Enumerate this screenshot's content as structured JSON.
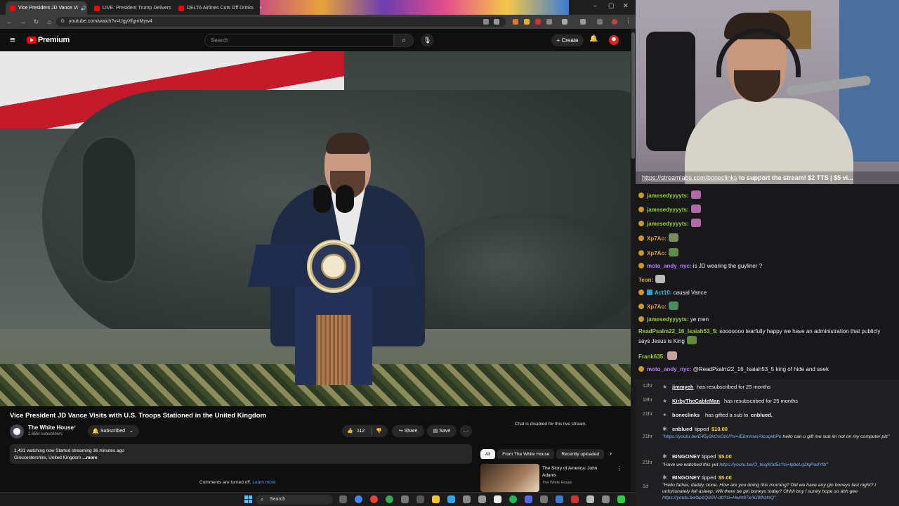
{
  "browser": {
    "tabs": [
      {
        "label": "Vice President JD Vance Vi"
      },
      {
        "label": "LIVE: President Trump Delivers"
      },
      {
        "label": "DELTA Airlines Cuts Off Drinks"
      }
    ],
    "new_tab": "+",
    "url": "youtube.com/watch?v=UgyXfgmMyw4",
    "win_min": "–",
    "win_max": "▢",
    "win_close": "✕"
  },
  "youtube": {
    "brand": "Premium",
    "search_placeholder": "Search",
    "create_label": "Create",
    "video": {
      "title": "Vice President JD Vance Visits with U.S. Troops Stationed in the United Kingdom",
      "channel": "The White House",
      "subscribers": "2.65M subscribers",
      "subscribed_label": "Subscribed",
      "likes": "112",
      "share_label": "Share",
      "save_label": "Save",
      "description_line1": "1,431 watching now  Started streaming 36 minutes ago",
      "description_line2": "Gloucestershire, United Kingdom",
      "description_more": "...more"
    },
    "comments_off": "Comments are turned off.",
    "learn_more": "Learn more",
    "chat_disabled": "Chat is disabled for this live stream.",
    "chips": [
      "All",
      "From The White House",
      "Recently uploaded"
    ],
    "recommendation": {
      "title": "The Story of America: John Adams",
      "channel": "The White House"
    }
  },
  "stream": {
    "ticker_link": "https://streamlabs.com/boneclinks",
    "ticker_text": " to support the stream! $2 TTS | $5 vi..."
  },
  "chat": {
    "messages": [
      {
        "user": "jamesedyyyyts:",
        "text": "",
        "color": "#9acd32",
        "emote": "#b06aa6"
      },
      {
        "user": "jamesedyyyyts:",
        "text": "",
        "color": "#9acd32",
        "emote": "#b06aa6"
      },
      {
        "user": "jamesedyyyyts:",
        "text": "",
        "color": "#9acd32",
        "emote": "#b06aa6"
      },
      {
        "user": "Xp7Ao:",
        "text": "",
        "color": "#daa520",
        "emote": "#7a8c5e"
      },
      {
        "user": "Xp7Ao:",
        "text": "",
        "color": "#daa520",
        "emote": "#5e8c4a"
      },
      {
        "user": "moto_andy_nyc:",
        "text": " is JD wearing the guyliner ?",
        "color": "#b77fff",
        "emote": ""
      },
      {
        "user": "Teon:",
        "text": "",
        "color": "#daa520",
        "emote": "#bbbbbb"
      },
      {
        "user": "Act10:",
        "text": " causal Vance",
        "color": "#1ec8e6",
        "emote": ""
      },
      {
        "user": "Xp7Ao:",
        "text": "",
        "color": "#daa520",
        "emote": "#4a8c5e"
      },
      {
        "user": "jamesedyyyyts:",
        "text": " ye men",
        "color": "#9acd32",
        "emote": ""
      },
      {
        "user": "ReadPsalm22_16_Isaiah53_5:",
        "text": " sooooooo tearfully happy we have an administration that publicly says Jesus is King",
        "color": "#9acd32",
        "emote": "#5f8c3a"
      },
      {
        "user": "Frank635:",
        "text": "",
        "color": "#9acd32",
        "emote": "#c7a0a0"
      },
      {
        "user": "moto_andy_nyc:",
        "text": " @ReadPsalm22_16_Isaiah53_5 king of hide and seek",
        "color": "#b77fff",
        "emote": ""
      }
    ]
  },
  "events": {
    "resubs": [
      {
        "time": "12hr",
        "name": "jimmyeh",
        "text": "has resubscribed for 25 months"
      },
      {
        "time": "18hr",
        "name": "KirbyTheCableMan",
        "text": "has resubscribed for 25 months"
      }
    ],
    "gift": {
      "time": "21hr",
      "name": "boneclinks",
      "text": "has gifted a sub to",
      "target": "cnblued."
    },
    "tips": [
      {
        "time": "21hr",
        "name": "cnblued",
        "tipped": "tipped",
        "amount": "$10.00",
        "link": "\"https://youtu.be/E45y2kOsOzU?si=IEbmmwrAlcoqxbPe",
        "message": " hello can u gift me sub im not on my computer plz\""
      },
      {
        "time": "21hr",
        "name": "BINGONEY",
        "tipped": "tipped",
        "amount": "$5.00",
        "link_prefix": "\"Have we watched this yet ",
        "link": "https://youtu.be/O_tesjK0d5s?si=lpbeLq2lqPodYfb",
        "message": "\""
      },
      {
        "time": "1d",
        "name": "BINGONEY",
        "tipped": "tipped",
        "amount": "$5.00",
        "message": "\"Hello father, daddy, bone. How are you doing this morning? Did we have any gin boneys last night? I unfortunately fell asleep. Will there be gin boneys today? Ohhh boy I surely hope so ahh gee",
        "link": "https://youtu.be/bp1Q9SV-d0?si=Hwln97xAU9fhzlnQ\""
      }
    ]
  },
  "taskbar": {
    "search_label": "Search"
  }
}
